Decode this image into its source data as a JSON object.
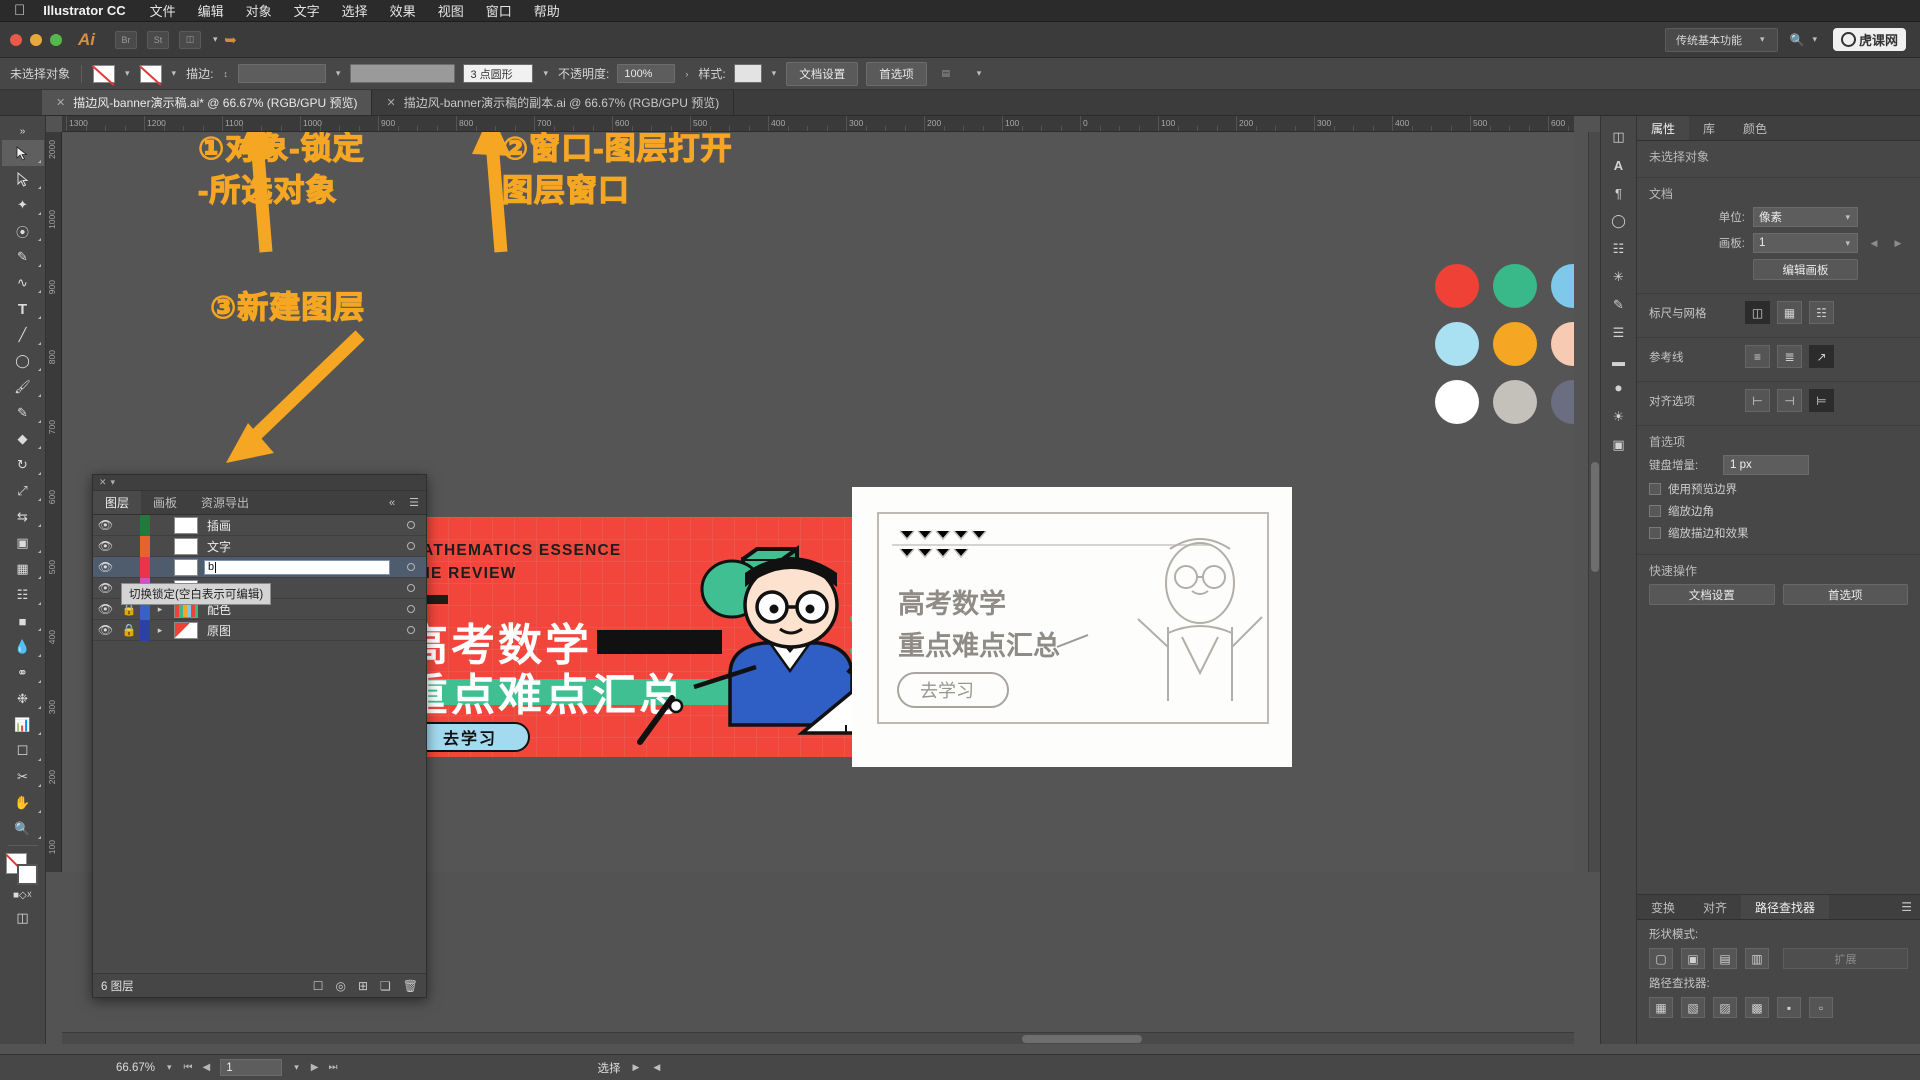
{
  "menubar": {
    "apple_icon": "apple-icon",
    "app_name": "Illustrator CC",
    "items": [
      "文件",
      "编辑",
      "对象",
      "文字",
      "选择",
      "效果",
      "视图",
      "窗口",
      "帮助"
    ]
  },
  "appbar": {
    "logo": "Ai",
    "buttons": [
      "Br",
      "St"
    ],
    "workspace_label": "传统基本功能",
    "search_placeholder": "",
    "brand_watermark": "虎课网"
  },
  "control_strip": {
    "selection_status": "未选择对象",
    "stroke_label": "描边:",
    "stroke_profile": "3 点圆形",
    "opacity_label": "不透明度:",
    "opacity_value": "100%",
    "style_label": "样式:",
    "doc_setup_button": "文档设置",
    "preferences_button": "首选项"
  },
  "tabs": [
    {
      "title": "描边风-banner演示稿.ai* @ 66.67% (RGB/GPU 预览)",
      "active": true
    },
    {
      "title": "描边风-banner演示稿的副本.ai @ 66.67% (RGB/GPU 预览)",
      "active": false
    }
  ],
  "ruler": {
    "h_ticks": [
      "1300",
      "1200",
      "1100",
      "1000",
      "900",
      "800",
      "700",
      "600",
      "500",
      "400",
      "300",
      "200",
      "100",
      "0",
      "100",
      "200",
      "300",
      "400",
      "500",
      "600"
    ],
    "v_ticks": [
      "2000",
      "1000",
      "900",
      "800",
      "700",
      "600",
      "500",
      "400",
      "300",
      "200",
      "100"
    ]
  },
  "annotations": [
    {
      "id": "anno-1",
      "text": "①对象-锁定\n-所选对象"
    },
    {
      "id": "anno-2",
      "text": "②窗口-图层打开\n图层窗口"
    },
    {
      "id": "anno-3",
      "text": "③新建图层"
    }
  ],
  "swatch_dots": [
    "#ef4136",
    "#39b98a",
    "#7ec8ea",
    "#a9e1f2",
    "#f5a623",
    "#f7cab4",
    "#ffffff",
    "#c4c0ba",
    "#6b6d80"
  ],
  "banner": {
    "english_line1": "MATHEMATICS ESSENCE",
    "english_line2": "THE REVIEW",
    "chinese_line1": "高考数学",
    "chinese_line2": "重点难点汇总",
    "cta": "去学习",
    "bg_color": "#f2463c",
    "accent_color": "#3fbf92",
    "cta_color": "#a4daf0"
  },
  "sketch": {
    "line1": "高考数学",
    "line2": "重点难点汇总",
    "cta": "去学习"
  },
  "layers_panel": {
    "tabs": [
      "图层",
      "画板",
      "资源导出"
    ],
    "collapse_icon": "chevron-double-left-icon",
    "menu_icon": "panel-menu-icon",
    "rows": [
      {
        "name": "插画",
        "color": "#1f7a3e",
        "visible": true,
        "locked": false,
        "expandable": false,
        "selected": false,
        "thumb": "blank"
      },
      {
        "name": "文字",
        "color": "#e8622b",
        "visible": true,
        "locked": false,
        "expandable": false,
        "selected": false,
        "thumb": "blank"
      },
      {
        "name": "",
        "color": "#e8344f",
        "visible": true,
        "locked": false,
        "expandable": false,
        "selected": true,
        "editing": true,
        "edit_value": "b",
        "thumb": "blank"
      },
      {
        "name": "",
        "color": "#d44fc0",
        "visible": true,
        "locked": false,
        "expandable": false,
        "selected": false,
        "thumb": "blank"
      },
      {
        "name": "配色",
        "color": "#3a5fc8",
        "visible": true,
        "locked": true,
        "expandable": true,
        "selected": false,
        "thumb": "swatches"
      },
      {
        "name": "原图",
        "color": "#2f3fa8",
        "visible": true,
        "locked": true,
        "expandable": true,
        "selected": false,
        "thumb": "image"
      }
    ],
    "tooltip": "切换锁定(空白表示可编辑)",
    "footer_count": "6 图层",
    "footer_icons": [
      "clip-mask-icon",
      "make-selection-icon",
      "new-sublayer-icon",
      "new-layer-icon",
      "delete-layer-icon"
    ]
  },
  "properties_panel": {
    "tabs": [
      "属性",
      "库",
      "颜色"
    ],
    "selection_status": "未选择对象",
    "document_section": {
      "title": "文档",
      "unit_label": "单位:",
      "unit_value": "像素",
      "artboard_label": "画板:",
      "artboard_value": "1",
      "edit_artboard_button": "编辑画板"
    },
    "rulers_grid": {
      "label": "标尺与网格",
      "icons": [
        "show-rulers-icon",
        "show-grid-icon",
        "show-transparency-grid-icon"
      ]
    },
    "guides": {
      "label": "参考线",
      "icons": [
        "show-guides-icon",
        "lock-guides-icon",
        "smart-guides-icon"
      ]
    },
    "align_options": {
      "label": "对齐选项",
      "icons": [
        "align-pixel-grid-icon",
        "align-glyph-icon",
        "align-point-icon"
      ]
    },
    "preferences_section": {
      "title": "首选项",
      "keyboard_increment_label": "键盘增量:",
      "keyboard_increment_value": "1 px",
      "checkboxes": [
        {
          "label": "使用预览边界",
          "checked": false
        },
        {
          "label": "缩放边角",
          "checked": false
        },
        {
          "label": "缩放描边和效果",
          "checked": false
        }
      ]
    },
    "quick_actions": {
      "title": "快速操作",
      "buttons": [
        "文档设置",
        "首选项"
      ]
    }
  },
  "pathfinder_panel": {
    "tabs": [
      "变换",
      "对齐",
      "路径查找器"
    ],
    "shape_modes_label": "形状模式:",
    "expand_button": "扩展",
    "pathfinders_label": "路径查找器:"
  },
  "dock_strip_icons": [
    "properties-icon",
    "character-icon",
    "paragraph-icon",
    "stroke-icon",
    "libraries-icon",
    "symbols-icon",
    "brushes-icon",
    "swatches-icon",
    "gradient-icon",
    "appearance-icon",
    "transparency-icon",
    "artboards-icon"
  ],
  "toolbar_icons": [
    "selection-tool",
    "direct-selection-tool",
    "magic-wand-tool",
    "lasso-tool",
    "pen-tool",
    "curvature-tool",
    "type-tool",
    "line-segment-tool",
    "ellipse-tool",
    "paintbrush-tool",
    "shaper-tool",
    "scissors-tool",
    "rotate-tool",
    "scale-tool",
    "width-tool",
    "free-transform-tool",
    "shape-builder-tool",
    "perspective-grid-tool",
    "mesh-tool",
    "gradient-tool",
    "eyedropper-tool",
    "blend-tool",
    "symbol-sprayer-tool",
    "column-graph-tool",
    "artboard-tool",
    "slice-tool",
    "hand-tool",
    "zoom-tool"
  ],
  "status_bar": {
    "zoom_level": "66.67%",
    "page_number": "1",
    "tool_name": "选择"
  }
}
